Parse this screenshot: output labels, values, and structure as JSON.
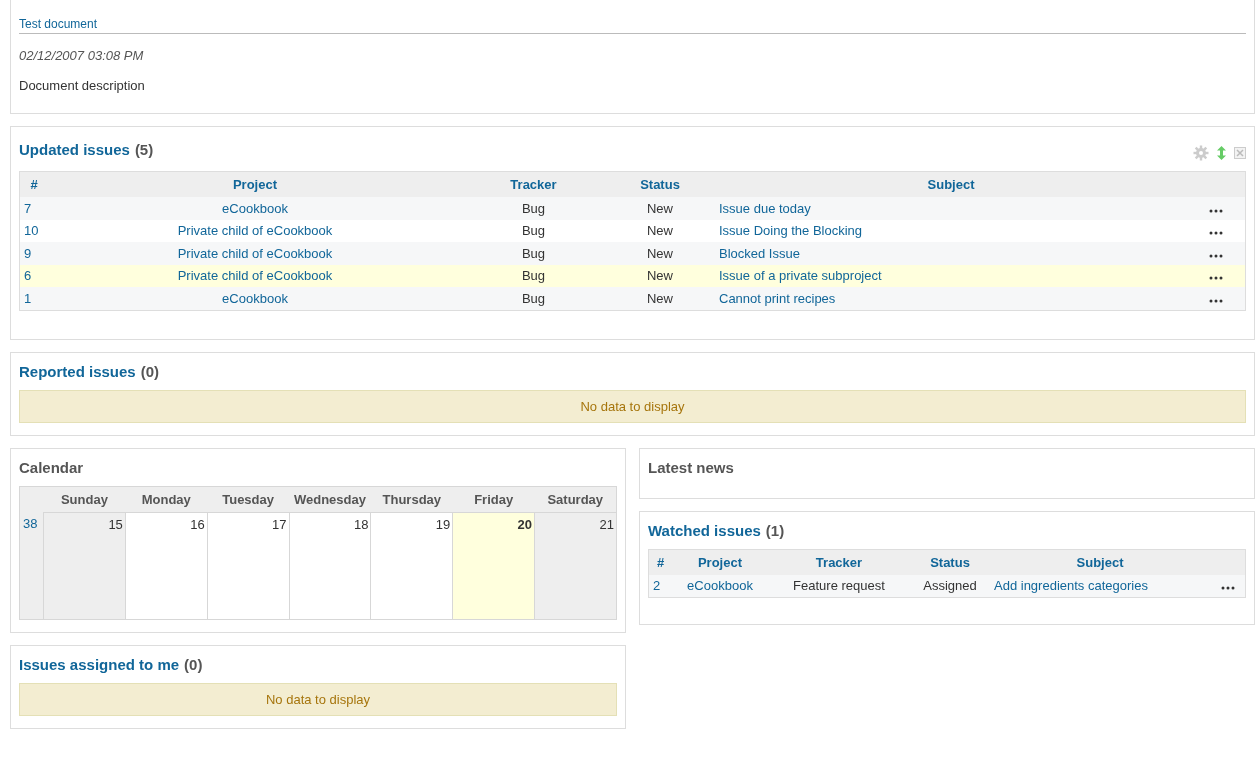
{
  "document": {
    "title": "Test document",
    "date": "02/12/2007 03:08 PM",
    "description": "Document description"
  },
  "updated_issues": {
    "title": "Updated issues",
    "count": "(5)",
    "columns": [
      "#",
      "Project",
      "Tracker",
      "Status",
      "Subject"
    ],
    "rows": [
      {
        "id": "7",
        "project": "eCookbook",
        "tracker": "Bug",
        "status": "New",
        "subject": "Issue due today",
        "highlighted": false
      },
      {
        "id": "10",
        "project": "Private child of eCookbook",
        "tracker": "Bug",
        "status": "New",
        "subject": "Issue Doing the Blocking",
        "highlighted": false
      },
      {
        "id": "9",
        "project": "Private child of eCookbook",
        "tracker": "Bug",
        "status": "New",
        "subject": "Blocked Issue",
        "highlighted": false
      },
      {
        "id": "6",
        "project": "Private child of eCookbook",
        "tracker": "Bug",
        "status": "New",
        "subject": "Issue of a private subproject",
        "highlighted": true
      },
      {
        "id": "1",
        "project": "eCookbook",
        "tracker": "Bug",
        "status": "New",
        "subject": "Cannot print recipes",
        "highlighted": false
      }
    ]
  },
  "reported_issues": {
    "title": "Reported issues",
    "count": "(0)",
    "empty_message": "No data to display"
  },
  "calendar": {
    "title": "Calendar",
    "weekdays": [
      "Sunday",
      "Monday",
      "Tuesday",
      "Wednesday",
      "Thursday",
      "Friday",
      "Saturday"
    ],
    "weeks": [
      {
        "number": "38",
        "days": [
          {
            "day": "15",
            "weekend": true,
            "today": false
          },
          {
            "day": "16",
            "weekend": false,
            "today": false
          },
          {
            "day": "17",
            "weekend": false,
            "today": false
          },
          {
            "day": "18",
            "weekend": false,
            "today": false
          },
          {
            "day": "19",
            "weekend": false,
            "today": false
          },
          {
            "day": "20",
            "weekend": false,
            "today": true
          },
          {
            "day": "21",
            "weekend": true,
            "today": false
          }
        ]
      }
    ]
  },
  "assigned_issues": {
    "title": "Issues assigned to me",
    "count": "(0)",
    "empty_message": "No data to display"
  },
  "latest_news": {
    "title": "Latest news"
  },
  "watched_issues": {
    "title": "Watched issues",
    "count": "(1)",
    "columns": [
      "#",
      "Project",
      "Tracker",
      "Status",
      "Subject"
    ],
    "rows": [
      {
        "id": "2",
        "project": "eCookbook",
        "tracker": "Feature request",
        "status": "Assigned",
        "subject": "Add ingredients categories",
        "highlighted": false
      }
    ]
  }
}
